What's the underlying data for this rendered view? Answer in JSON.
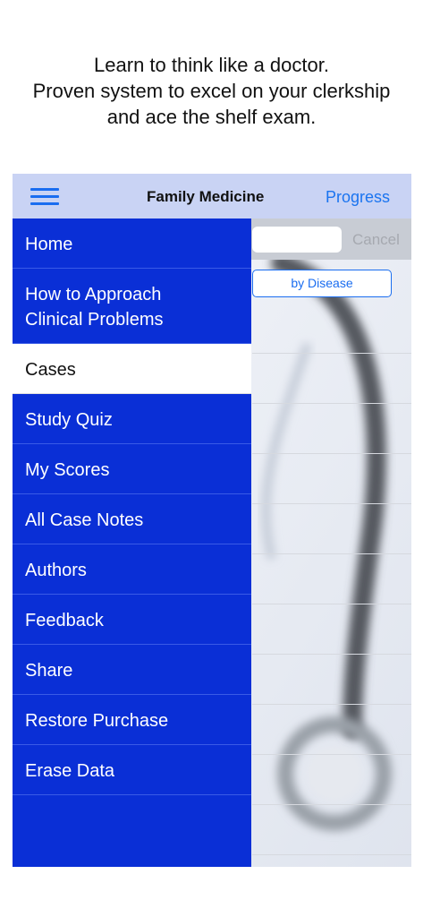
{
  "tagline": {
    "line1": "Learn to think like a doctor.",
    "line2": "Proven system to excel on your clerkship",
    "line3": "and ace the shelf exam."
  },
  "navbar": {
    "title": "Family Medicine",
    "progress_label": "Progress",
    "menu_icon": "hamburger-menu-icon"
  },
  "search": {
    "placeholder": "",
    "cancel_label": "Cancel"
  },
  "segment": {
    "label": "by Disease"
  },
  "menu": {
    "items": [
      {
        "label": "Home"
      },
      {
        "label": "How to Approach Clinical Problems"
      },
      {
        "label": "Cases"
      },
      {
        "label": "Study Quiz"
      },
      {
        "label": "My Scores"
      },
      {
        "label": "All Case Notes"
      },
      {
        "label": "Authors"
      },
      {
        "label": "Feedback"
      },
      {
        "label": "Share"
      },
      {
        "label": "Restore Purchase"
      },
      {
        "label": "Erase Data"
      }
    ],
    "selected": "Cases"
  },
  "colors": {
    "drawer": "#0a2fd6",
    "navbar": "#c9d3f4",
    "accent": "#1a74f0"
  }
}
